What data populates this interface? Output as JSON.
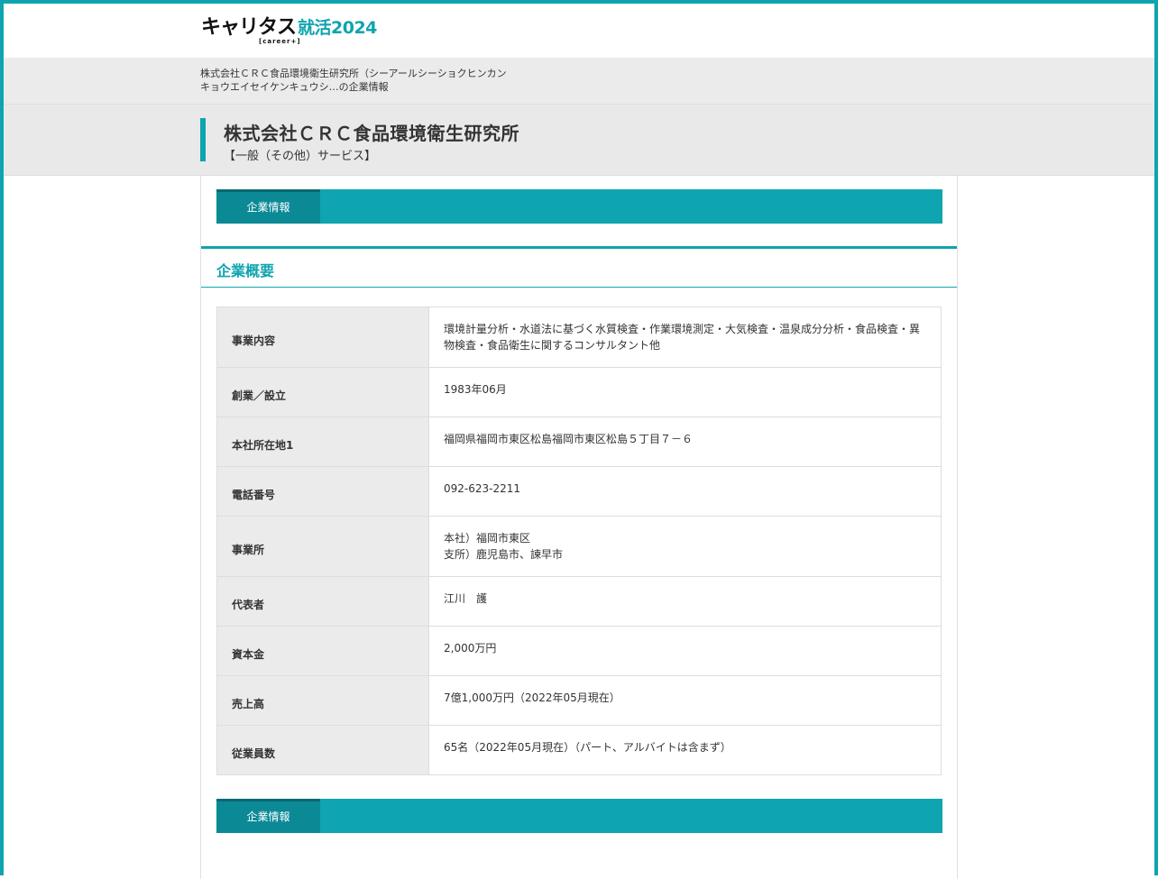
{
  "header": {
    "logo_main": "キャリタス",
    "logo_sub": "[career+]",
    "logo_accent": "就活2024"
  },
  "breadcrumb": {
    "line1": "株式会社ＣＲＣ食品環境衛生研究所（シーアールシーショクヒンカン",
    "line2": "キョウエイセイケンキュウシ…の企業情報"
  },
  "company": {
    "name": "株式会社ＣＲＣ食品環境衛生研究所",
    "industry": "【一般（その他）サービス】"
  },
  "tabs": {
    "top": "企業情報",
    "bottom": "企業情報"
  },
  "section": {
    "title": "企業概要"
  },
  "info_rows": [
    {
      "label": "事業内容",
      "value_lines": [
        "環境計量分析・水道法に基づく水質検査・作業環境測定・大気検査・温泉成分分析・食品検査・異",
        "物検査・食品衛生に関するコンサルタント他"
      ]
    },
    {
      "label": "創業／設立",
      "value_lines": [
        "1983年06月"
      ]
    },
    {
      "label": "本社所在地1",
      "value_lines": [
        "福岡県福岡市東区松島福岡市東区松島５丁目７－６"
      ]
    },
    {
      "label": "電話番号",
      "value_lines": [
        "092-623-2211"
      ]
    },
    {
      "label": "事業所",
      "value_lines": [
        "本社）福岡市東区",
        "支所）鹿児島市、諫早市"
      ]
    },
    {
      "label": "代表者",
      "value_lines": [
        "江川　護"
      ]
    },
    {
      "label": "資本金",
      "value_lines": [
        "2,000万円"
      ]
    },
    {
      "label": "売上高",
      "value_lines": [
        "7億1,000万円（2022年05月現在）"
      ]
    },
    {
      "label": "従業員数",
      "value_lines": [
        "65名（2022年05月現在）（パート、アルバイトは含まず）"
      ]
    }
  ],
  "colors": {
    "accent": "#0ea4b0",
    "tab_active": "#0b8a96",
    "label_bg": "#ebebeb"
  }
}
